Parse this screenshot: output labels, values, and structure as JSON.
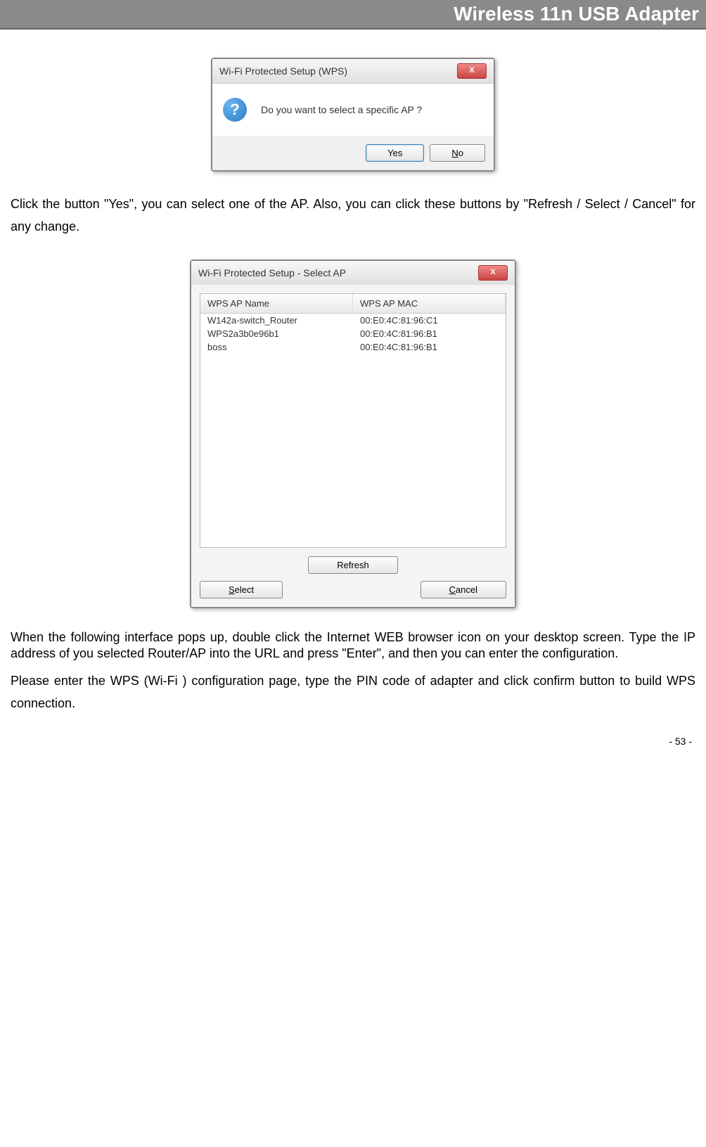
{
  "header": {
    "title": "Wireless 11n USB Adapter"
  },
  "dialog1": {
    "title": "Wi-Fi Protected Setup (WPS)",
    "close": "X",
    "icon": "?",
    "message": "Do you want to select a specific AP ?",
    "yes": "Yes",
    "no": "No"
  },
  "paragraph1": "Click the button \"Yes\", you can select one of the AP. Also, you can click these buttons by \"Refresh / Select / Cancel\" for any change.",
  "dialog2": {
    "title": "Wi-Fi Protected Setup - Select AP",
    "close": "X",
    "col_name": "WPS AP Name",
    "col_mac": "WPS AP MAC",
    "rows": [
      {
        "name": "W142a-switch_Router",
        "mac": "00:E0:4C:81:96:C1"
      },
      {
        "name": "WPS2a3b0e96b1",
        "mac": "00:E0:4C:81:96:B1"
      },
      {
        "name": "boss",
        "mac": "00:E0:4C:81:96:B1"
      }
    ],
    "refresh": "Refresh",
    "select": "Select",
    "cancel": "Cancel"
  },
  "paragraph2": "When the following interface pops up, double click the Internet WEB browser icon on your desktop screen. Type the IP address of you selected Router/AP into the URL and press \"Enter\", and then you can enter the configuration.",
  "paragraph3": "Please enter the WPS (Wi-Fi ) configuration page, type the PIN code of adapter and click confirm button to build WPS connection.",
  "page_number": "- 53 -"
}
